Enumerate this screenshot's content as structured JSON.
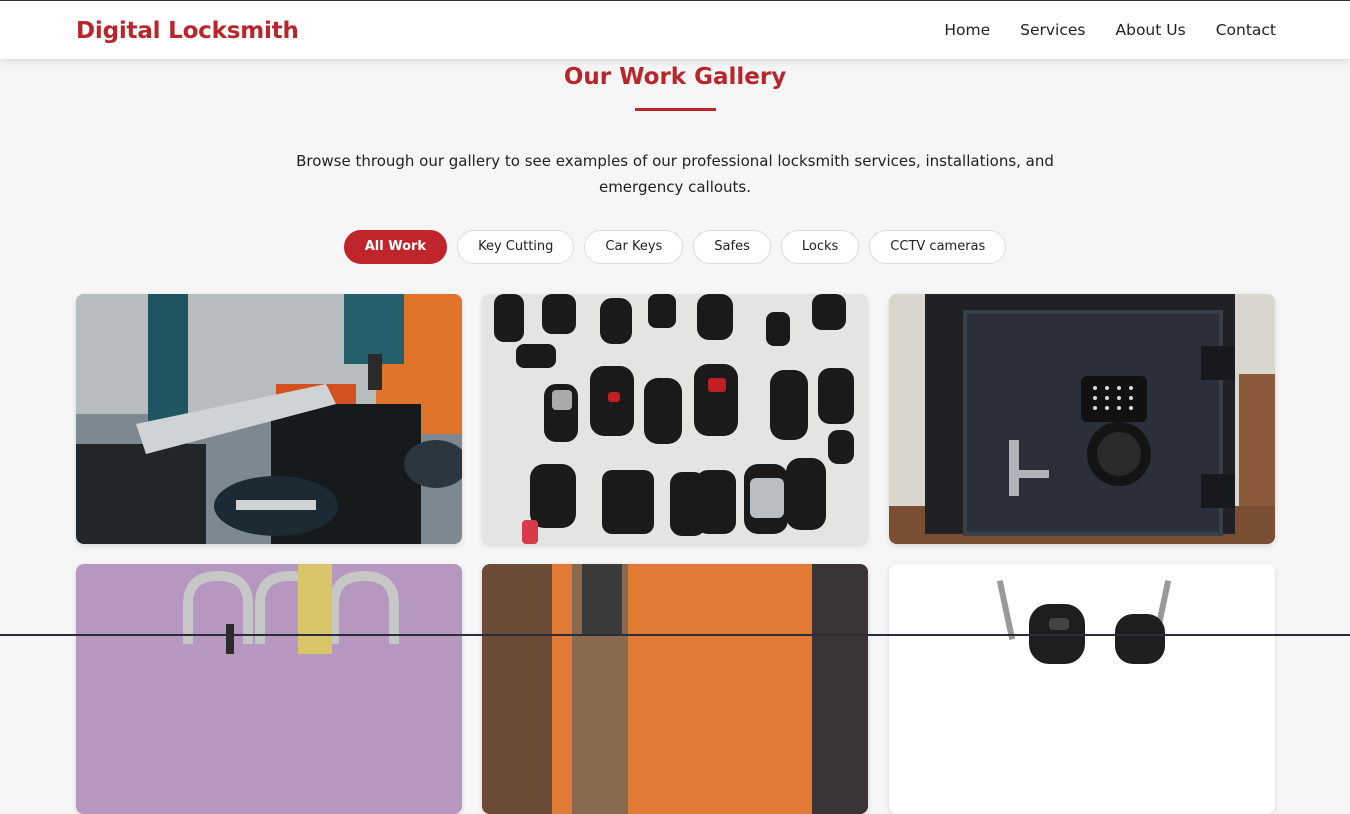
{
  "header": {
    "brand": "Digital Locksmith",
    "nav": [
      "Home",
      "Services",
      "About Us",
      "Contact"
    ]
  },
  "gallery": {
    "title": "Our Work Gallery",
    "intro": "Browse through our gallery to see examples of our professional locksmith services, installations, and emergency callouts.",
    "filters": [
      "All Work",
      "Key Cutting",
      "Car Keys",
      "Safes",
      "Locks",
      "CCTV cameras"
    ],
    "active_filter": "All Work"
  },
  "colors": {
    "brand": "#b8262b",
    "active_filter": "#c0252b"
  },
  "images": [
    "key-cutting-machine-photo",
    "car-key-fobs-photo",
    "digital-safe-photo",
    "padlocks-photo",
    "drill-photo",
    "car-keys-photo"
  ]
}
